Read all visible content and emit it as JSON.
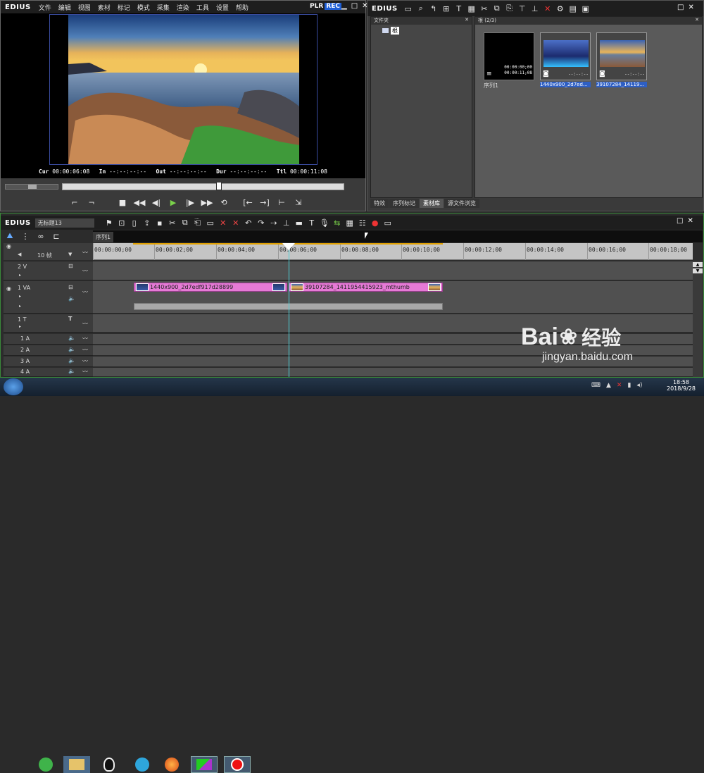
{
  "player": {
    "brand": "EDIUS",
    "menu": [
      "文件",
      "编辑",
      "视图",
      "素材",
      "标记",
      "模式",
      "采集",
      "渲染",
      "工具",
      "设置",
      "帮助"
    ],
    "mode_plr": "PLR",
    "mode_rec": "REC",
    "timecodes": {
      "cur_label": "Cur",
      "cur": "00:00:06:08",
      "in_label": "In",
      "in": "--:--:--:--",
      "out_label": "Out",
      "out": "--:--:--:--",
      "dur_label": "Dur",
      "dur": "--:--:--:--",
      "ttl_label": "Ttl",
      "ttl": "00:00:11:08"
    }
  },
  "bin": {
    "brand": "EDIUS",
    "folder_header": "文件夹",
    "root_label": "根",
    "content_header": "根 (2/3)",
    "items": [
      {
        "name": "序列1",
        "tc1": "00:00:00;00",
        "tc2": "00:00:11;08"
      },
      {
        "name": "1440x900_2d7ed...",
        "tc1": "--:--:--",
        "tc2": ""
      },
      {
        "name": "39107284_14119...",
        "tc1": "--:--:--",
        "tc2": ""
      }
    ],
    "tabs": [
      "特效",
      "序列标记",
      "素材库",
      "源文件浏览"
    ]
  },
  "timeline": {
    "brand": "EDIUS",
    "project_name": "无标题13",
    "sequence_tab": "序列1",
    "zoom_label": "10 帧",
    "ruler": [
      "00:00:00;00",
      "00:00:02;00",
      "00:00:04;00",
      "00:00:06;00",
      "00:00:08;00",
      "00:00:10;00",
      "00:00:12;00",
      "00:00:14;00",
      "00:00:16;00",
      "00:00:18;00"
    ],
    "tracks": {
      "v2": "2 V",
      "va1": "1 VA",
      "t1": "1 T",
      "a1": "1 A",
      "a2": "2 A",
      "a3": "3 A",
      "a4": "4 A"
    },
    "clips": {
      "clip1": "1440x900_2d7edf917d28899",
      "clip2": "39107284_1411954415923_mthumb"
    }
  },
  "taskbar": {
    "time": "18:58",
    "date": "2018/9/28"
  },
  "watermark": {
    "brand": "Bai",
    "brand2": "经验",
    "url": "jingyan.baidu.com"
  }
}
